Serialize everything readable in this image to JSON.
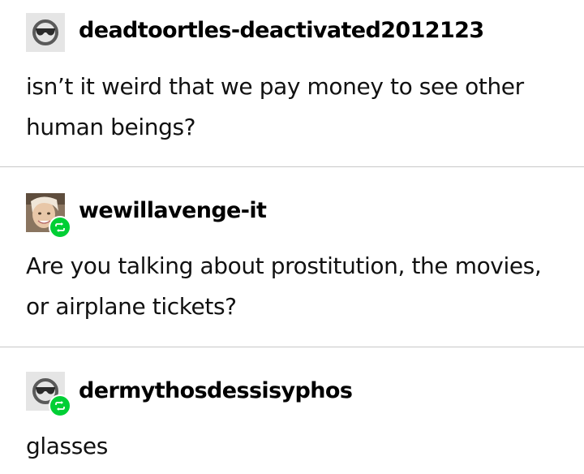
{
  "posts": [
    {
      "username": "deadtoortles-deactivated2012123",
      "body": "isn’t it weird that we pay money to see other human beings?",
      "avatar": "default-sunglasses-avatar",
      "reblogged": false
    },
    {
      "username": "wewillavenge-it",
      "body": "Are you talking about prostitution, the movies, or airplane tickets?",
      "avatar": "photo-avatar",
      "reblogged": true
    },
    {
      "username": "dermythosdessisyphos",
      "body": "glasses",
      "avatar": "default-sunglasses-avatar",
      "reblogged": true
    }
  ],
  "colors": {
    "reblog_badge": "#00cf35",
    "divider": "#c8c8c8",
    "text": "#111111"
  }
}
